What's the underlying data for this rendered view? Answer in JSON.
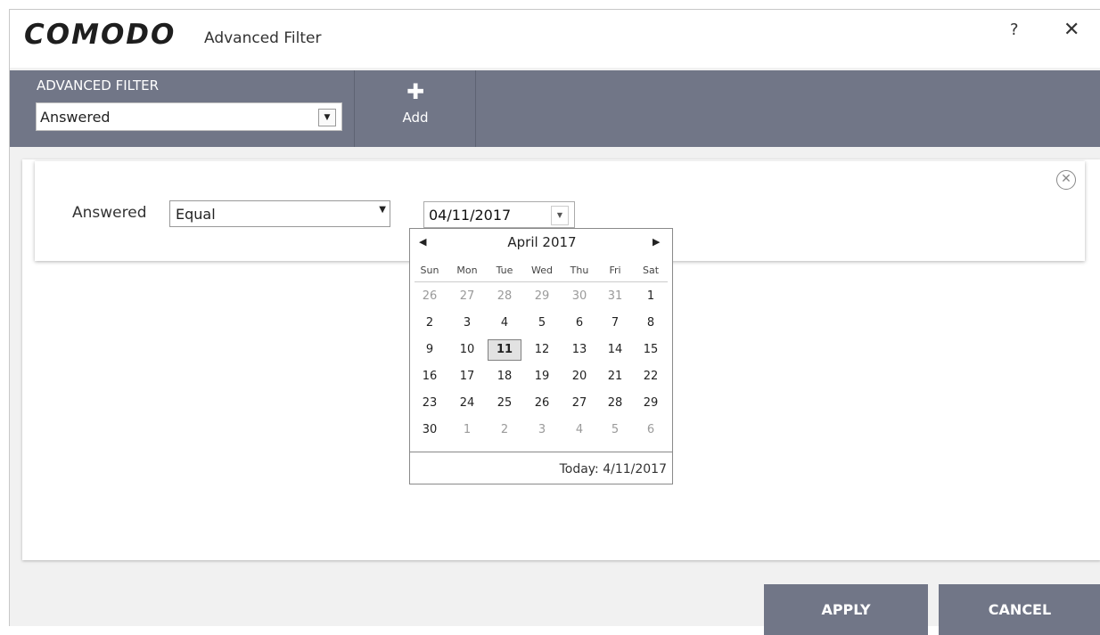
{
  "window": {
    "logo": "COMODO",
    "title": "Advanced Filter",
    "help_glyph": "?",
    "close_glyph": "✕"
  },
  "toolbar": {
    "filter_label": "ADVANCED FILTER",
    "filter_value": "Answered",
    "add_glyph": "✚",
    "add_label": "Add"
  },
  "condition": {
    "field_label": "Answered",
    "operator": "Equal",
    "date_value": "04/11/2017",
    "remove_glyph": "✕"
  },
  "calendar": {
    "month_label": "April 2017",
    "prev_glyph": "◀",
    "next_glyph": "▶",
    "weekdays": [
      "Sun",
      "Mon",
      "Tue",
      "Wed",
      "Thu",
      "Fri",
      "Sat"
    ],
    "weeks": [
      [
        "26",
        "27",
        "28",
        "29",
        "30",
        "31",
        "1"
      ],
      [
        "2",
        "3",
        "4",
        "5",
        "6",
        "7",
        "8"
      ],
      [
        "9",
        "10",
        "11",
        "12",
        "13",
        "14",
        "15"
      ],
      [
        "16",
        "17",
        "18",
        "19",
        "20",
        "21",
        "22"
      ],
      [
        "23",
        "24",
        "25",
        "26",
        "27",
        "28",
        "29"
      ],
      [
        "30",
        "1",
        "2",
        "3",
        "4",
        "5",
        "6"
      ]
    ],
    "selected_day": "11",
    "today_label": "Today: 4/11/2017"
  },
  "buttons": {
    "apply": "APPLY",
    "cancel": "CANCEL"
  },
  "icons": {
    "help": "question-icon",
    "close": "close-icon",
    "add": "plus-icon",
    "remove": "circle-x-icon",
    "dropdown": "chevron-down-icon",
    "prev": "arrow-left-icon",
    "next": "arrow-right-icon"
  },
  "colors": {
    "toolbar": "#717687",
    "button": "#717687",
    "window_bg": "#f1f1f1"
  }
}
